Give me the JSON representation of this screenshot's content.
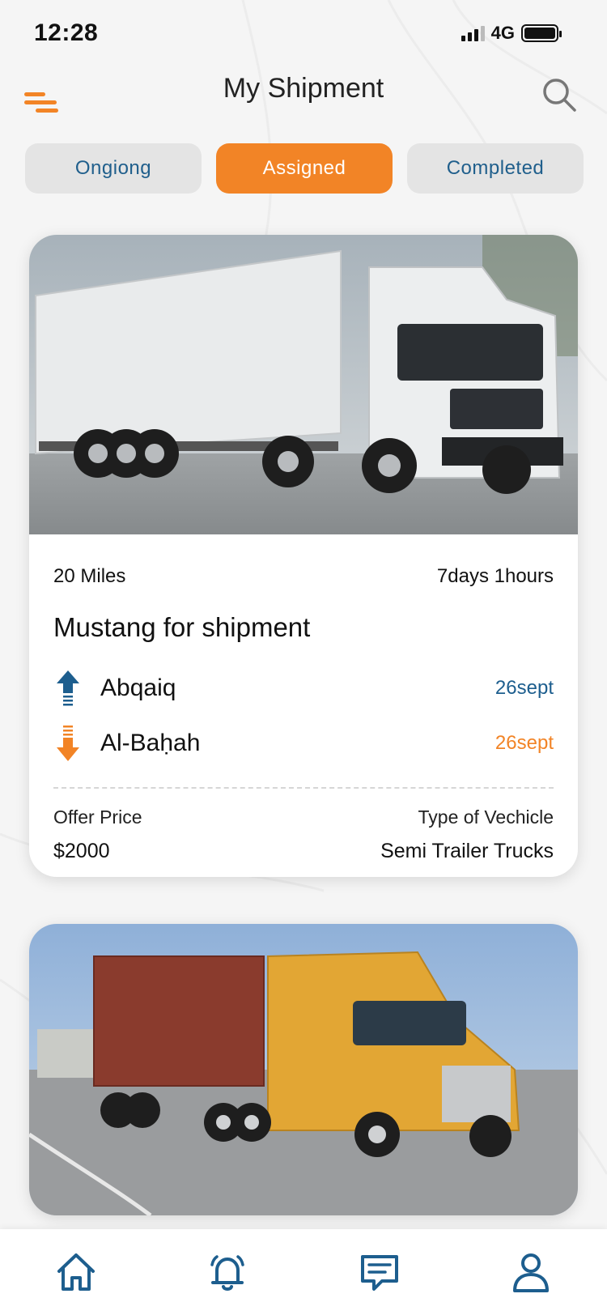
{
  "status": {
    "time": "12:28",
    "network": "4G",
    "battery_level": 1.0
  },
  "header": {
    "title": "My Shipment"
  },
  "tabs": [
    {
      "label": "Ongiong",
      "active": false
    },
    {
      "label": "Assigned",
      "active": true
    },
    {
      "label": "Completed",
      "active": false
    }
  ],
  "shipments": [
    {
      "distance": "20 Miles",
      "duration": "7days 1hours",
      "name": "Mustang for shipment",
      "origin": {
        "place": "Abqaiq",
        "day": "26",
        "month": "sept"
      },
      "destination": {
        "place": "Al-Baḥah",
        "day": "26",
        "month": "sept"
      },
      "offer_label": "Offer Price",
      "offer_value": "$2000",
      "vehicle_label": "Type of Vechicle",
      "vehicle_value": "Semi Trailer Trucks"
    }
  ],
  "colors": {
    "accent": "#f28426",
    "primary": "#1d5e8e"
  },
  "nav": [
    "home-icon",
    "bell-icon",
    "chat-icon",
    "profile-icon"
  ]
}
